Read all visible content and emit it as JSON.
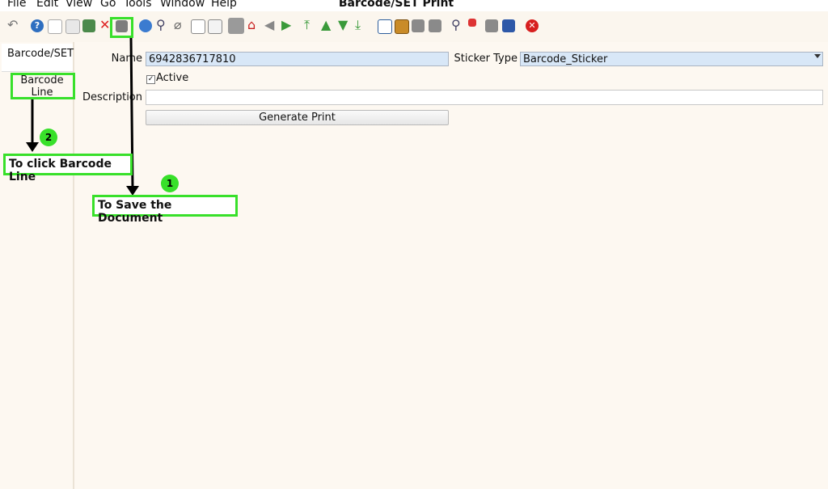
{
  "menu": {
    "items": [
      {
        "label": "File"
      },
      {
        "label": "Edit"
      },
      {
        "label": "View"
      },
      {
        "label": "Go"
      },
      {
        "label": "Tools"
      },
      {
        "label": "Window"
      },
      {
        "label": "Help"
      }
    ],
    "window_title": "Barcode/SET Print"
  },
  "sidebar": {
    "tab_label": "Barcode/SET",
    "line_label_1": "Barcode",
    "line_label_2": "Line"
  },
  "form": {
    "name_label": "Name",
    "name_value": "6942836717810",
    "sticker_type_label": "Sticker Type",
    "sticker_type_value": "Barcode_Sticker",
    "active_label": "Active",
    "description_label": "Description",
    "description_value": "",
    "generate_button": "Generate Print"
  },
  "annotations": {
    "step1_number": "1",
    "step1_text": "To Save the Document",
    "step2_number": "2",
    "step2_text": "To click Barcode Line"
  },
  "colors": {
    "highlight": "#38e02a",
    "field_bg": "#d8e7f7"
  }
}
